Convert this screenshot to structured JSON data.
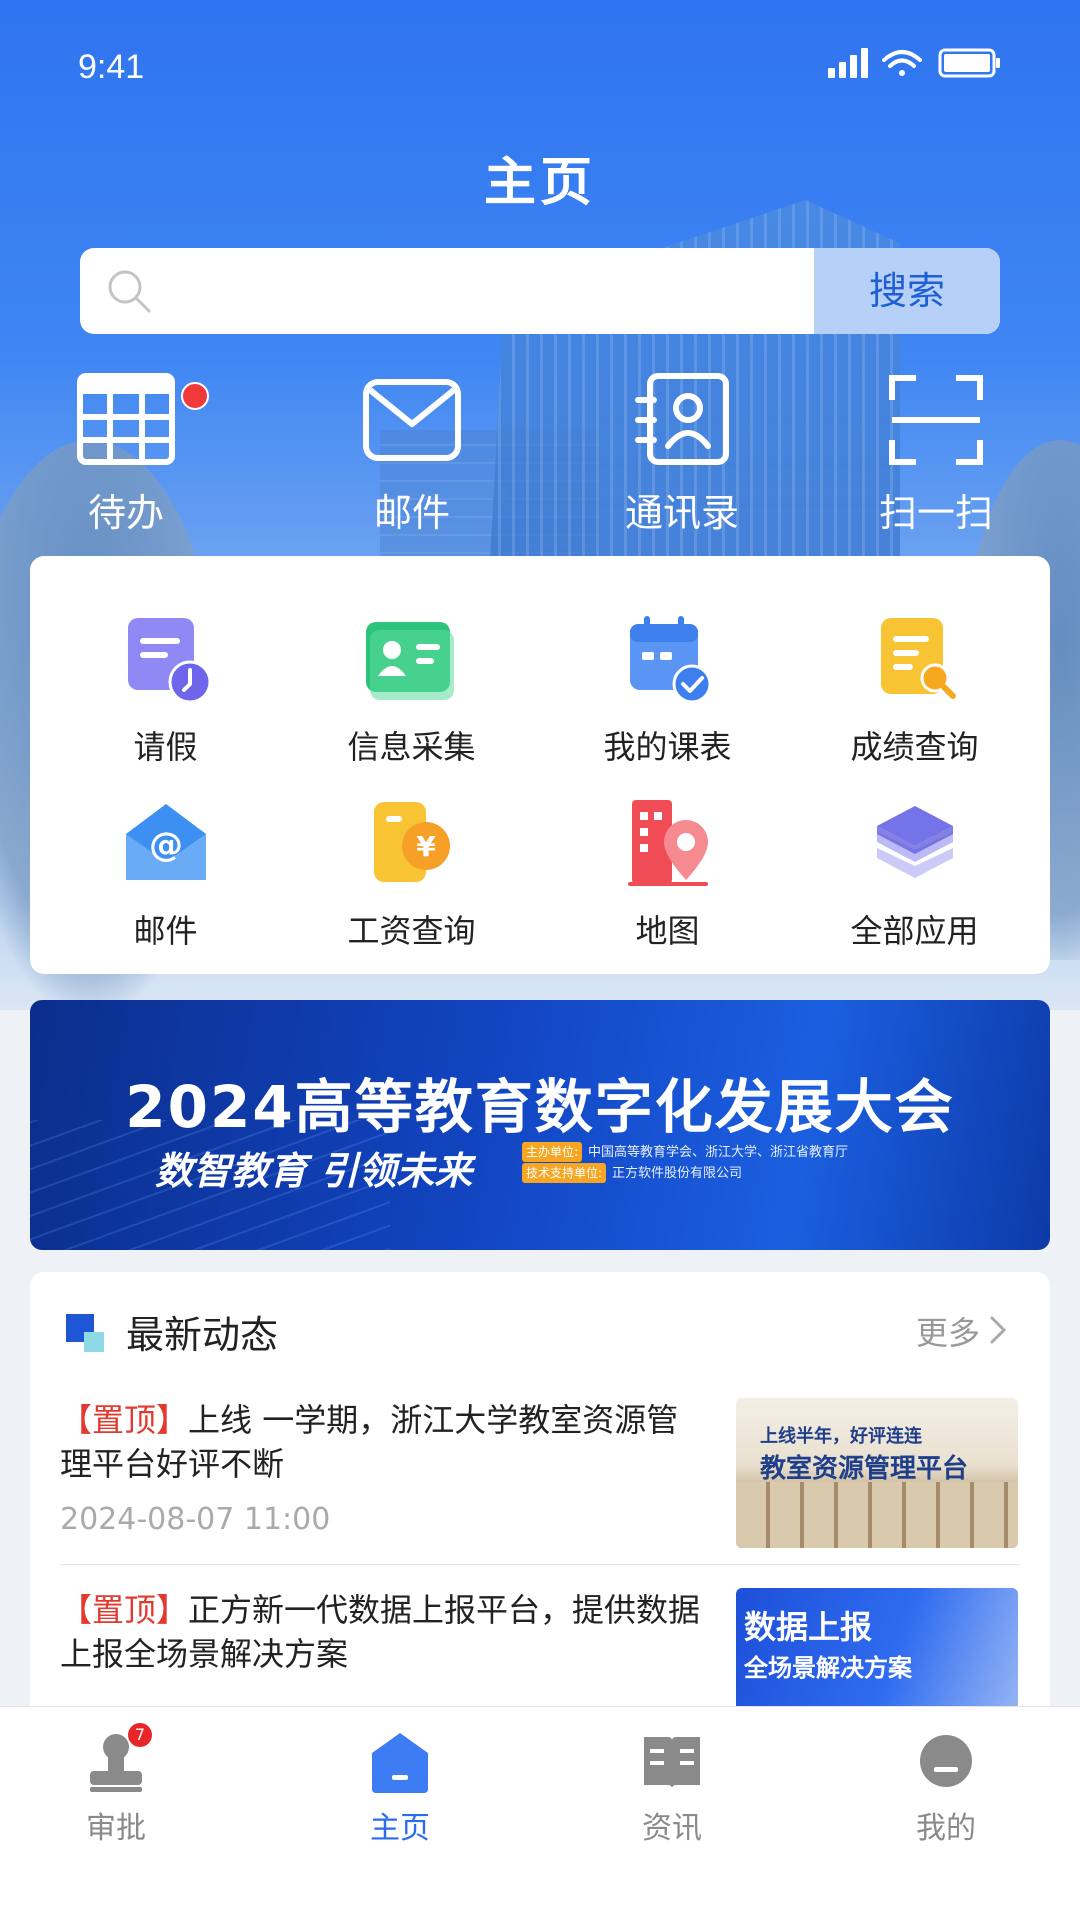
{
  "status_bar": {
    "time": "9:41"
  },
  "header": {
    "title": "主页"
  },
  "search": {
    "placeholder": "",
    "button_label": "搜索"
  },
  "quick_actions": [
    {
      "label": "待办",
      "icon": "calendar-grid-icon",
      "has_dot": true
    },
    {
      "label": "邮件",
      "icon": "envelope-icon"
    },
    {
      "label": "通讯录",
      "icon": "contacts-icon"
    },
    {
      "label": "扫一扫",
      "icon": "scan-icon"
    }
  ],
  "apps": [
    {
      "label": "请假",
      "icon": "leave-icon",
      "color": "#8b84f3"
    },
    {
      "label": "信息采集",
      "icon": "id-card-icon",
      "color": "#2fc77e"
    },
    {
      "label": "我的课表",
      "icon": "schedule-icon",
      "color": "#4f8cf2"
    },
    {
      "label": "成绩查询",
      "icon": "grade-search-icon",
      "color": "#f7b92c"
    },
    {
      "label": "邮件",
      "icon": "mail-at-icon",
      "color": "#3a8ef0"
    },
    {
      "label": "工资查询",
      "icon": "salary-icon",
      "color": "#f6b12b"
    },
    {
      "label": "地图",
      "icon": "map-pin-building-icon",
      "color": "#f0525b"
    },
    {
      "label": "全部应用",
      "icon": "layers-icon",
      "color": "#7a78e6"
    }
  ],
  "banner": {
    "title": "2024高等教育数字化发展大会",
    "slogan": "数智教育  引领未来",
    "host_tag": "主办单位:",
    "host": "中国高等教育学会、浙江大学、浙江省教育厅",
    "support_tag": "技术支持单位:",
    "support": "正方软件股份有限公司"
  },
  "news": {
    "section_title": "最新动态",
    "more_label": "更多",
    "items": [
      {
        "tag": "【置顶】",
        "title": "上线 一学期，浙江大学教室资源管理平台好评不断",
        "date": "2024-08-07   11:00",
        "thumb_line1": "上线半年，好评连连",
        "thumb_line2": "教室资源管理平台"
      },
      {
        "tag": "【置顶】",
        "title": "正方新一代数据上报平台，提供数据上报全场景解决方案",
        "thumb_line1": "数据上报",
        "thumb_line2": "全场景解决方案"
      }
    ]
  },
  "tabbar": {
    "items": [
      {
        "label": "审批",
        "icon": "approval-stamp-icon",
        "badge": "7"
      },
      {
        "label": "主页",
        "icon": "home-icon",
        "active": true
      },
      {
        "label": "资讯",
        "icon": "news-book-icon"
      },
      {
        "label": "我的",
        "icon": "profile-icon"
      }
    ]
  }
}
